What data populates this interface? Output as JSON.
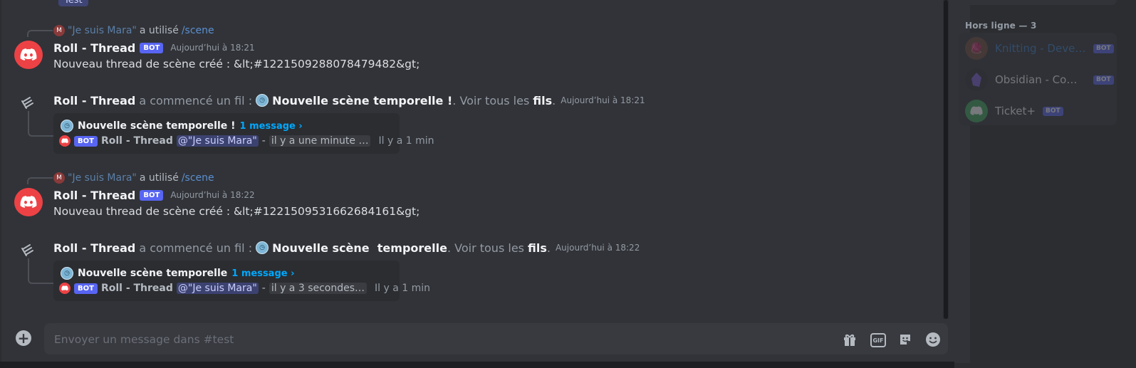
{
  "top_partial": {
    "label": "Test"
  },
  "messages": [
    {
      "reply": {
        "user": "\"Je suis Mara\"",
        "verb": "a utilisé",
        "command": "/scene"
      },
      "author": "Roll - Thread",
      "bot_tag": "BOT",
      "timestamp": "Aujourd’hui à 18:21",
      "text": "Nouveau thread de scène créé : &lt;#1221509288078479482&gt;"
    },
    {
      "reply": {
        "user": "\"Je suis Mara\"",
        "verb": "a utilisé",
        "command": "/scene"
      },
      "author": "Roll - Thread",
      "bot_tag": "BOT",
      "timestamp": "Aujourd’hui à 18:22",
      "text": "Nouveau thread de scène créé : &lt;#1221509531662684161&gt;"
    }
  ],
  "threads": [
    {
      "author": "Roll - Thread",
      "started": "a commencé un fil :",
      "name": "Nouvelle scène temporelle !",
      "see_all": ". Voir tous les",
      "fils": "fils",
      "dot": ".",
      "timestamp": "Aujourd’hui à 18:21",
      "card_name": "Nouvelle scène temporelle !",
      "card_count": "1 message ›",
      "last_bot_tag": "BOT",
      "last_author": "Roll - Thread",
      "last_mention": "@\"Je suis Mara\"",
      "dash": "-",
      "last_preview": "il y a une minute …",
      "last_ago": "Il y a 1 min"
    },
    {
      "author": "Roll - Thread",
      "started": "a commencé un fil :",
      "name": "Nouvelle scène  temporelle",
      "see_all": ". Voir tous les",
      "fils": "fils",
      "dot": ".",
      "timestamp": "Aujourd’hui à 18:22",
      "card_name": "Nouvelle scène temporelle",
      "card_count": "1 message ›",
      "last_bot_tag": "BOT",
      "last_author": "Roll - Thread",
      "last_mention": "@\"Je suis Mara\"",
      "dash": "-",
      "last_preview": "il y a 3 secondes…",
      "last_ago": "Il y a 1 min"
    }
  ],
  "composer": {
    "placeholder": "Envoyer un message dans #test"
  },
  "members": {
    "offline_title": "Hors ligne — 3",
    "list": [
      {
        "name": "Knitting - Develo…",
        "bot_tag": "BOT",
        "avatar_icon": "knitting-avatar",
        "color": "#3b7dc9"
      },
      {
        "name": "Obsidian - Comm…",
        "bot_tag": "BOT",
        "avatar_icon": "obsidian-avatar",
        "color": "#7c5cd6"
      },
      {
        "name": "Ticket+",
        "bot_tag": "BOT",
        "avatar_icon": "discord-avatar",
        "color": "#3ba55c"
      }
    ]
  },
  "colors": {
    "accent": "#5865f2",
    "link": "#00a8fc",
    "bot_avatar": "#ed4245"
  }
}
